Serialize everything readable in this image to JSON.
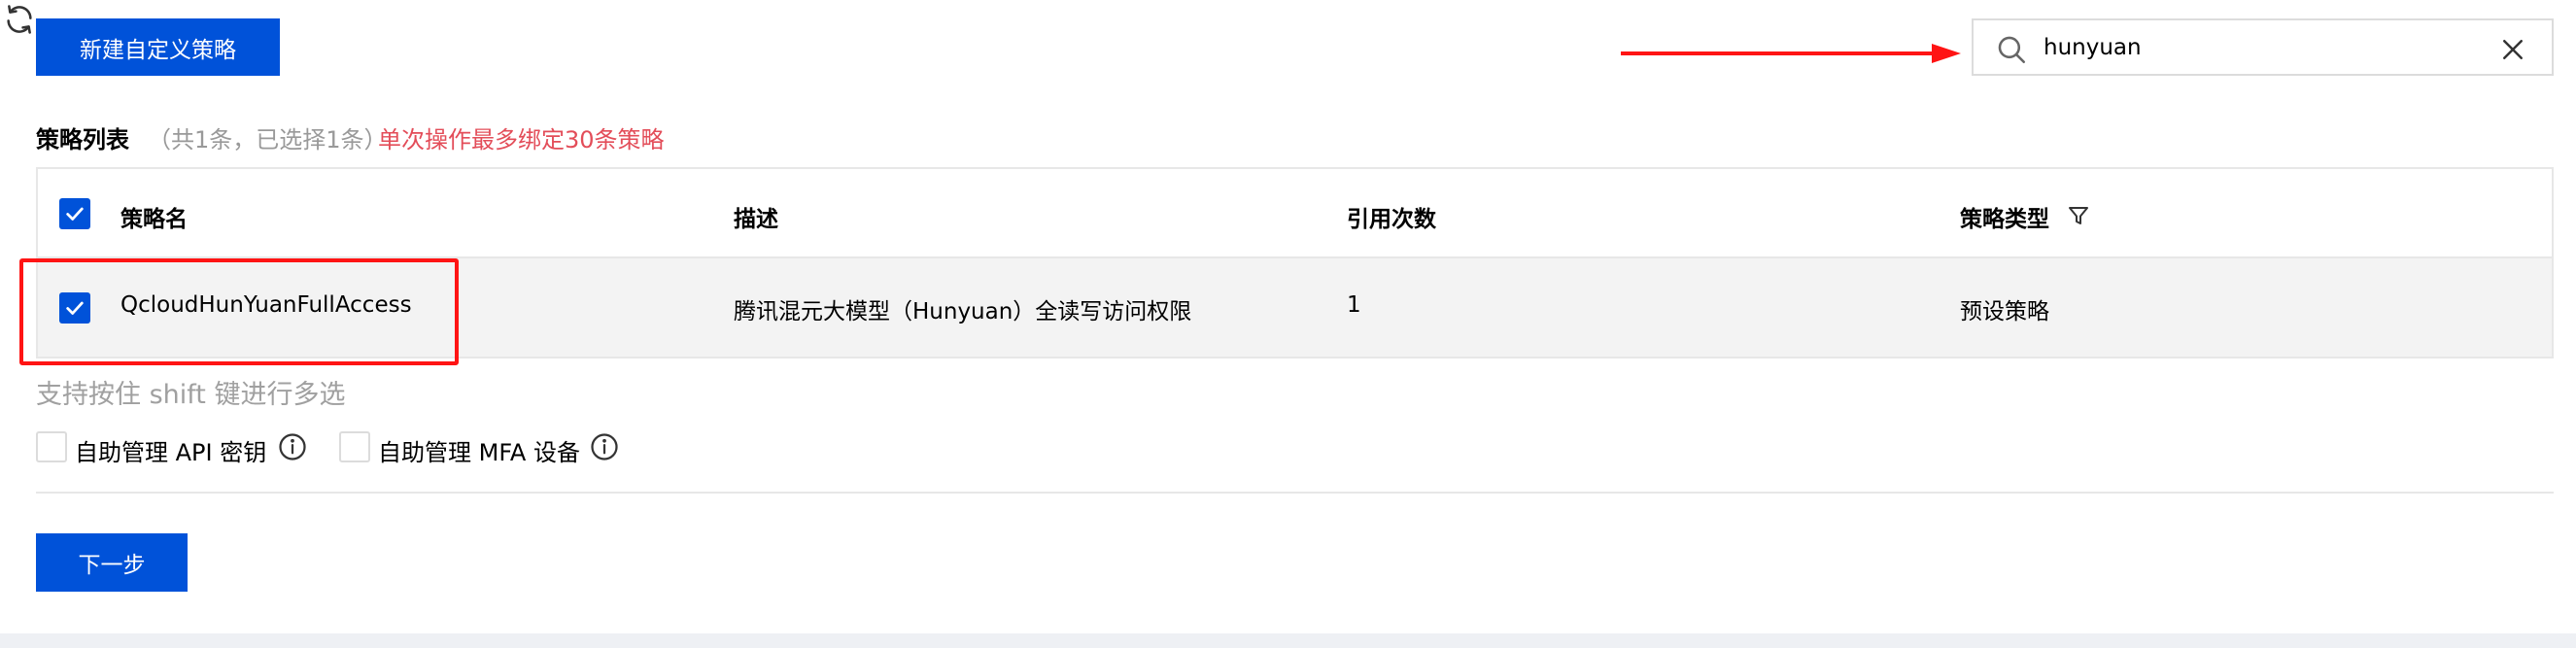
{
  "toolbar": {
    "new_policy_label": "新建自定义策略",
    "refresh_icon": "refresh-icon"
  },
  "search": {
    "value": "hunyuan",
    "icon": "search-icon",
    "clear_icon": "close-icon"
  },
  "list": {
    "title": "策略列表",
    "count_text": "（共1条，已选择1条）",
    "limit_text": "单次操作最多绑定30条策略"
  },
  "table": {
    "columns": [
      "策略名",
      "描述",
      "引用次数",
      "策略类型"
    ],
    "filter_icon": "filter-icon",
    "rows": [
      {
        "selected": true,
        "name": "QcloudHunYuanFullAccess",
        "description": "腾讯混元大模型（Hunyuan）全读写访问权限",
        "references": "1",
        "type": "预设策略"
      }
    ]
  },
  "hint": "支持按住 shift 键进行多选",
  "options": {
    "api_key": "自助管理 API 密钥",
    "mfa": "自助管理 MFA 设备"
  },
  "footer": {
    "next_label": "下一步"
  },
  "colors": {
    "primary": "#0052d9",
    "warning_text": "#e34d59",
    "annotation": "#ff1414"
  }
}
